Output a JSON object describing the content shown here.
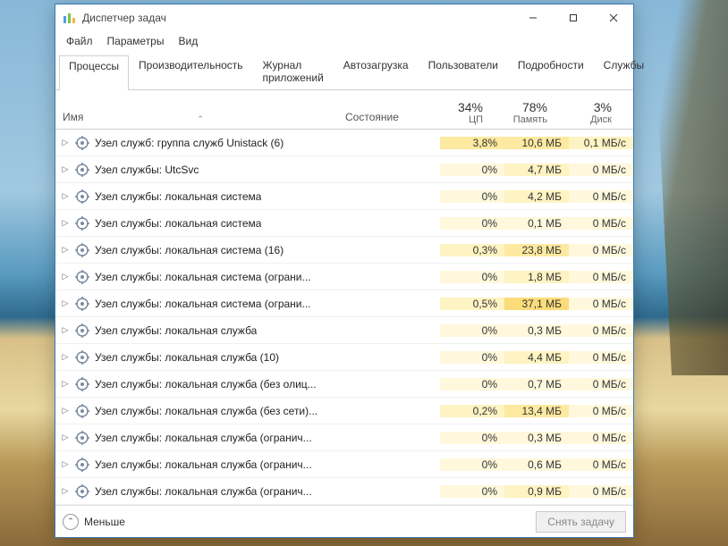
{
  "window": {
    "title": "Диспетчер задач"
  },
  "menu": {
    "file": "Файл",
    "options": "Параметры",
    "view": "Вид"
  },
  "tabs": {
    "processes": "Процессы",
    "performance": "Производительность",
    "apphistory": "Журнал приложений",
    "startup": "Автозагрузка",
    "users": "Пользователи",
    "details": "Подробности",
    "services": "Службы"
  },
  "columns": {
    "name": "Имя",
    "state": "Состояние",
    "cpu_pct": "34%",
    "cpu_lbl": "ЦП",
    "mem_pct": "78%",
    "mem_lbl": "Память",
    "disk_pct": "3%",
    "disk_lbl": "Диск"
  },
  "rows": [
    {
      "name": "Узел служб: группа служб Unistack (6)",
      "cpu": "3,8%",
      "mem": "10,6 МБ",
      "disk": "0,1 МБ/с",
      "cpu_tint": "tint3",
      "mem_tint": "tint3",
      "disk_tint": "tint2"
    },
    {
      "name": "Узел службы: UtcSvc",
      "cpu": "0%",
      "mem": "4,7 МБ",
      "disk": "0 МБ/с",
      "cpu_tint": "tint1",
      "mem_tint": "tint2",
      "disk_tint": "tint1"
    },
    {
      "name": "Узел службы: локальная система",
      "cpu": "0%",
      "mem": "4,2 МБ",
      "disk": "0 МБ/с",
      "cpu_tint": "tint1",
      "mem_tint": "tint2",
      "disk_tint": "tint1"
    },
    {
      "name": "Узел службы: локальная система",
      "cpu": "0%",
      "mem": "0,1 МБ",
      "disk": "0 МБ/с",
      "cpu_tint": "tint1",
      "mem_tint": "tint1",
      "disk_tint": "tint1"
    },
    {
      "name": "Узел службы: локальная система (16)",
      "cpu": "0,3%",
      "mem": "23,8 МБ",
      "disk": "0 МБ/с",
      "cpu_tint": "tint2",
      "mem_tint": "tint3",
      "disk_tint": "tint1"
    },
    {
      "name": "Узел службы: локальная система (ограни...",
      "cpu": "0%",
      "mem": "1,8 МБ",
      "disk": "0 МБ/с",
      "cpu_tint": "tint1",
      "mem_tint": "tint2",
      "disk_tint": "tint1"
    },
    {
      "name": "Узел службы: локальная система (ограни...",
      "cpu": "0,5%",
      "mem": "37,1 МБ",
      "disk": "0 МБ/с",
      "cpu_tint": "tint2",
      "mem_tint": "tint4",
      "disk_tint": "tint1"
    },
    {
      "name": "Узел службы: локальная служба",
      "cpu": "0%",
      "mem": "0,3 МБ",
      "disk": "0 МБ/с",
      "cpu_tint": "tint1",
      "mem_tint": "tint1",
      "disk_tint": "tint1"
    },
    {
      "name": "Узел службы: локальная служба (10)",
      "cpu": "0%",
      "mem": "4,4 МБ",
      "disk": "0 МБ/с",
      "cpu_tint": "tint1",
      "mem_tint": "tint2",
      "disk_tint": "tint1"
    },
    {
      "name": "Узел службы: локальная служба (без олиц...",
      "cpu": "0%",
      "mem": "0,7 МБ",
      "disk": "0 МБ/с",
      "cpu_tint": "tint1",
      "mem_tint": "tint1",
      "disk_tint": "tint1"
    },
    {
      "name": "Узел службы: локальная служба (без сети)...",
      "cpu": "0,2%",
      "mem": "13,4 МБ",
      "disk": "0 МБ/с",
      "cpu_tint": "tint2",
      "mem_tint": "tint3",
      "disk_tint": "tint1"
    },
    {
      "name": "Узел службы: локальная служба (огранич...",
      "cpu": "0%",
      "mem": "0,3 МБ",
      "disk": "0 МБ/с",
      "cpu_tint": "tint1",
      "mem_tint": "tint1",
      "disk_tint": "tint1"
    },
    {
      "name": "Узел службы: локальная служба (огранич...",
      "cpu": "0%",
      "mem": "0,6 МБ",
      "disk": "0 МБ/с",
      "cpu_tint": "tint1",
      "mem_tint": "tint1",
      "disk_tint": "tint1"
    },
    {
      "name": "Узел службы: локальная служба (огранич...",
      "cpu": "0%",
      "mem": "0,9 МБ",
      "disk": "0 МБ/с",
      "cpu_tint": "tint1",
      "mem_tint": "tint2",
      "disk_tint": "tint1"
    }
  ],
  "footer": {
    "fewer": "Меньше",
    "end_task": "Снять задачу"
  }
}
